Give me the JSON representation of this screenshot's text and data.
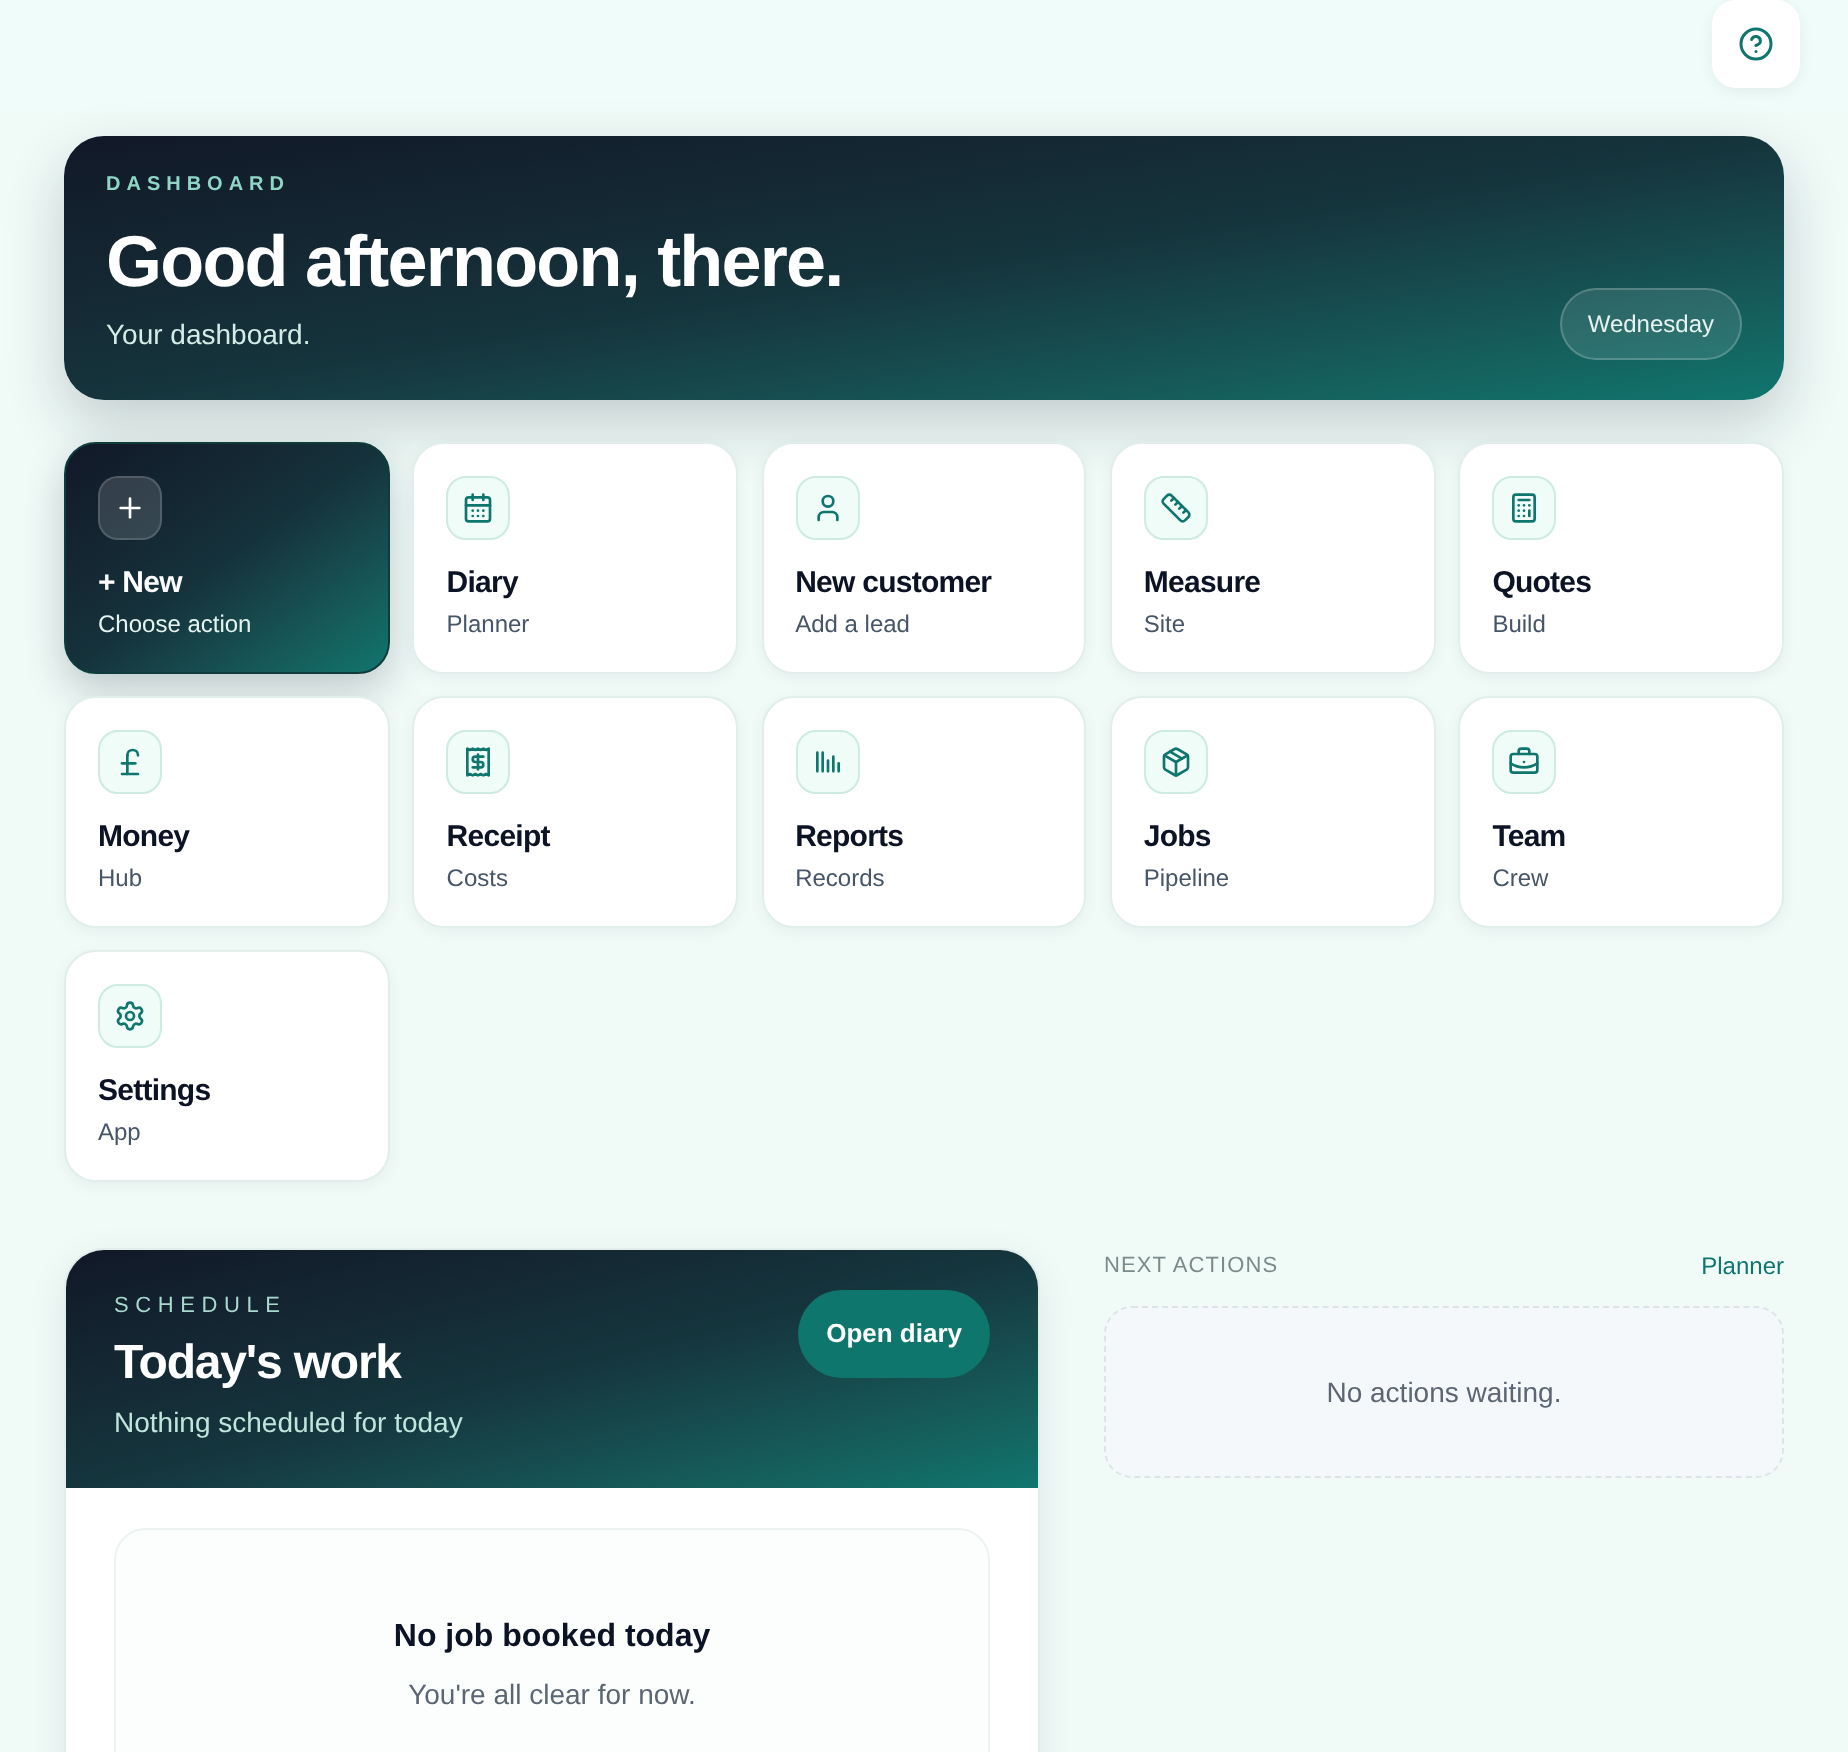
{
  "hero": {
    "eyebrow": "DASHBOARD",
    "title": "Good afternoon, there.",
    "subtitle": "Your dashboard.",
    "day_badge": "Wednesday"
  },
  "tiles": [
    {
      "kind": "accent",
      "title": "+ New",
      "subtitle": "Choose action"
    },
    {
      "kind": "standard",
      "title": "Diary",
      "subtitle": "Planner"
    },
    {
      "kind": "standard",
      "title": "New customer",
      "subtitle": "Add a lead"
    },
    {
      "kind": "standard",
      "title": "Measure",
      "subtitle": "Site"
    },
    {
      "kind": "standard",
      "title": "Quotes",
      "subtitle": "Build"
    },
    {
      "kind": "standard",
      "title": "Money",
      "subtitle": "Hub"
    },
    {
      "kind": "standard",
      "title": "Receipt",
      "subtitle": "Costs"
    },
    {
      "kind": "standard",
      "title": "Reports",
      "subtitle": "Records"
    },
    {
      "kind": "standard",
      "title": "Jobs",
      "subtitle": "Pipeline"
    },
    {
      "kind": "standard",
      "title": "Team",
      "subtitle": "Crew"
    },
    {
      "kind": "standard",
      "title": "Settings",
      "subtitle": "App"
    }
  ],
  "schedule": {
    "eyebrow": "SCHEDULE",
    "title": "Today's work",
    "subtitle": "Nothing scheduled for today",
    "button": "Open diary",
    "empty_title": "No job booked today",
    "empty_text": "You're all clear for now."
  },
  "next_actions": {
    "heading": "NEXT ACTIONS",
    "link": "Planner",
    "empty_text": "No actions waiting."
  }
}
